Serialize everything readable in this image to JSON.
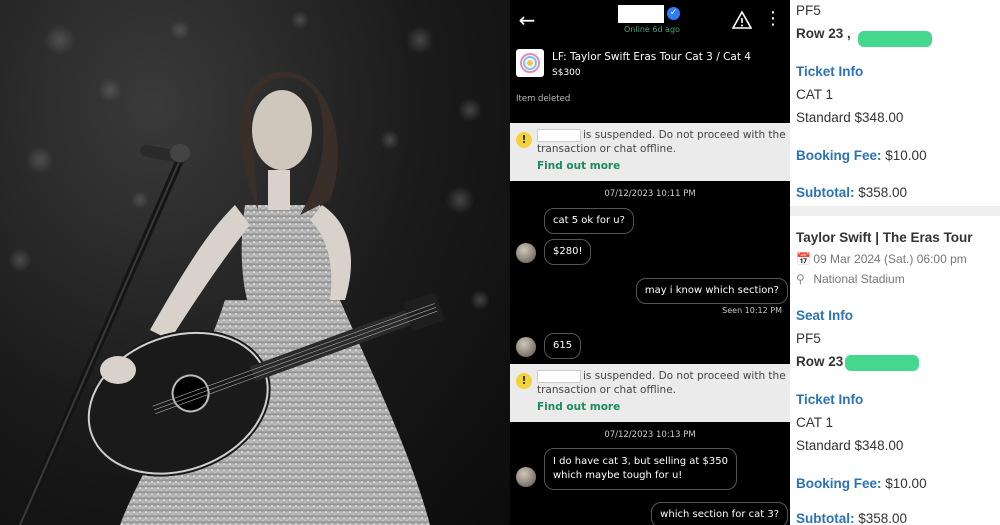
{
  "chat": {
    "online_status": "Online 6d ago",
    "item": {
      "title": "LF: Taylor Swift Eras Tour Cat 3 / Cat 4",
      "price": "S$300",
      "status": "Item deleted"
    },
    "warning": {
      "line1": "is suspended. Do not proceed with the",
      "line2": "transaction or chat offline.",
      "link": "Find out more"
    },
    "messages": [
      {
        "type": "timestamp",
        "text": "07/12/2023 10:11 PM"
      },
      {
        "type": "in",
        "text": "cat 5 ok for u?"
      },
      {
        "type": "in",
        "text": "$280!"
      },
      {
        "type": "out",
        "text": "may i know which section?"
      },
      {
        "type": "seen",
        "text": "Seen 10:12 PM"
      },
      {
        "type": "in",
        "text": "615"
      },
      {
        "type": "timestamp",
        "text": "07/12/2023 10:13 PM"
      },
      {
        "type": "in",
        "text": "I do have cat 3, but selling at $350"
      },
      {
        "type": "in_cont",
        "text": "which maybe tough for u!"
      },
      {
        "type": "out",
        "text": "which section for cat 3?"
      }
    ],
    "icons": {
      "back": "back-arrow-icon",
      "verified": "verified-badge-icon",
      "alert": "warning-triangle-icon",
      "more": "more-vertical-icon"
    }
  },
  "tickets": {
    "top": {
      "section": "PF5",
      "row": "Row 23 ,",
      "ticket_info_label": "Ticket Info",
      "category": "CAT 1",
      "standard": "Standard $348.00",
      "booking_fee_label": "Booking Fee:",
      "booking_fee_value": "$10.00",
      "subtotal_label": "Subtotal:",
      "subtotal_value": "$358.00"
    },
    "second": {
      "event": "Taylor Swift | The Eras Tour",
      "date": "09 Mar 2024 (Sat.) 06:00 pm",
      "venue": "National Stadium",
      "seat_info_label": "Seat Info",
      "section": "PF5",
      "row": "Row 23",
      "ticket_info_label": "Ticket Info",
      "category": "CAT 1",
      "standard": "Standard $348.00",
      "booking_fee_label": "Booking Fee:",
      "booking_fee_value": "$10.00",
      "subtotal_label": "Subtotal:",
      "subtotal_value": "$358.00"
    },
    "colors": {
      "heading_blue": "#2c72b8",
      "redaction_green": "#45d78e"
    }
  },
  "photo": {
    "description_icon": "performer-with-guitar-photo"
  }
}
